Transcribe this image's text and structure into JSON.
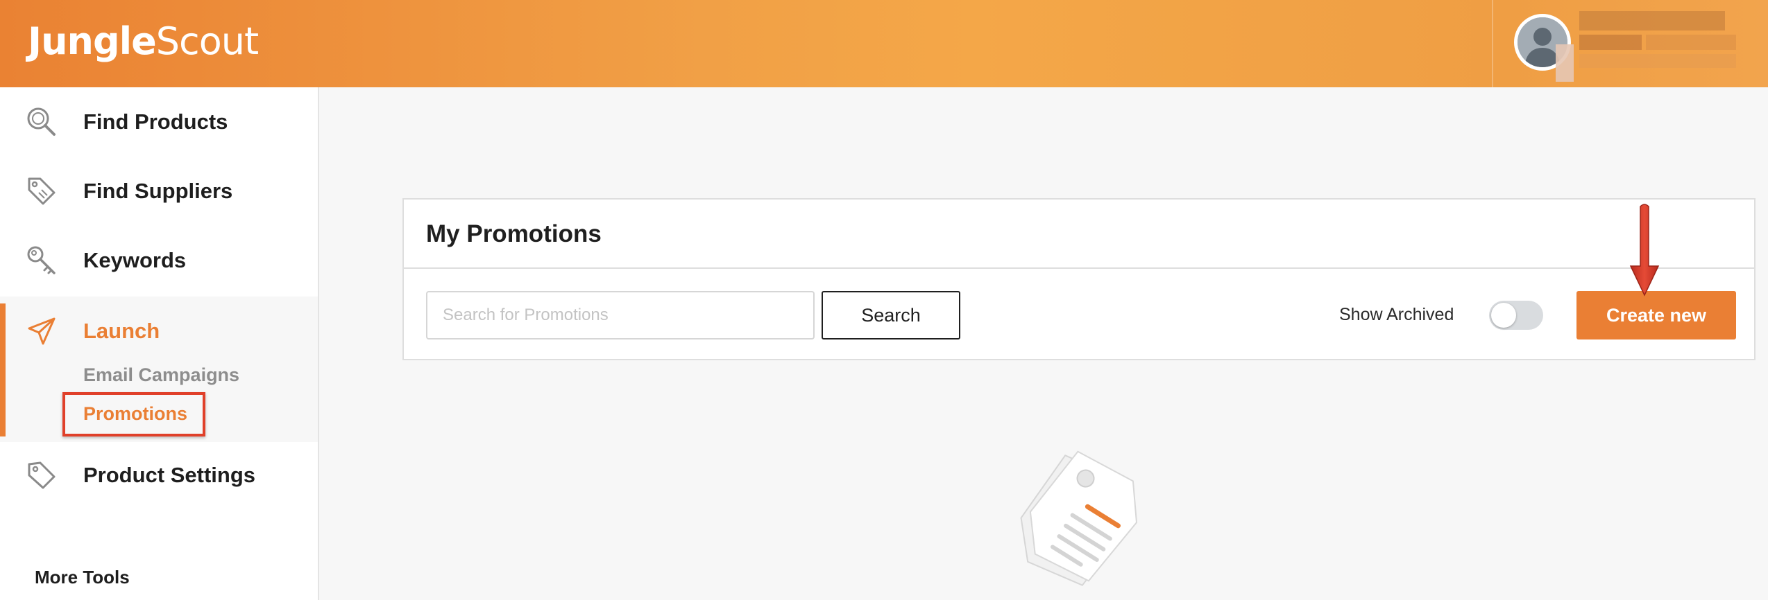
{
  "header": {
    "logo_bold": "Jungle",
    "logo_light": "Scout"
  },
  "sidebar": {
    "items": [
      {
        "label": "Find Products",
        "icon": "search-icon"
      },
      {
        "label": "Find Suppliers",
        "icon": "tag-icon"
      },
      {
        "label": "Keywords",
        "icon": "key-icon"
      },
      {
        "label": "Launch",
        "icon": "paper-plane-icon"
      },
      {
        "label": "Product Settings",
        "icon": "price-tag-icon"
      }
    ],
    "launch_subitems": [
      {
        "label": "Email Campaigns"
      },
      {
        "label": "Promotions"
      }
    ],
    "more_tools": "More Tools"
  },
  "main": {
    "title": "My Promotions",
    "search_placeholder": "Search for Promotions",
    "search_label": "Search",
    "show_archived_label": "Show Archived",
    "show_archived": false,
    "create_label": "Create new"
  },
  "colors": {
    "accent": "#ea7f34",
    "highlight_box": "#e0402a",
    "annotation_arrow": "#d93a2b"
  }
}
